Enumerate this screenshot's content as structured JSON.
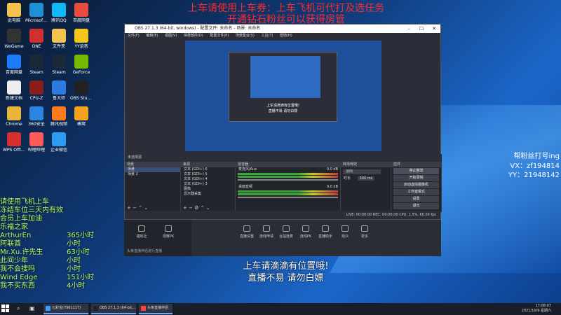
{
  "overlay": {
    "top_line1": "上车请使用上车券：上车飞机可代打及选任务",
    "top_line2": "开通钻石粉丝可以获得房管",
    "subtitle_line1": "上车请滴滴有位置哦!",
    "subtitle_line2": "直播不易 请勿白嫖",
    "fan_title": "帮粉丝打号ing",
    "fan_vx": "VX：zf194814",
    "fan_yy": "YY：21948142"
  },
  "chat": [
    {
      "name": "请使用飞机上车",
      "value": ""
    },
    {
      "name": "冻结车位三天内有效",
      "value": ""
    },
    {
      "name": "会员上车加油",
      "value": ""
    },
    {
      "name": "乐福之家",
      "value": ""
    },
    {
      "name": "ArthurEn",
      "value": "365小时"
    },
    {
      "name": "阿联酋",
      "value": "小时"
    },
    {
      "name": "Mr.Xu.许先生",
      "value": "63小时"
    },
    {
      "name": "此间少年",
      "value": "小时"
    },
    {
      "name": "我不会搜吗",
      "value": "小时"
    },
    {
      "name": "Wind Edge",
      "value": "151小时"
    },
    {
      "name": "我不买东西",
      "value": "4小时"
    }
  ],
  "obs": {
    "title": "OBS 27.1.3 (64-bit, windows) - 配置文件: 未命名 - 场景: 未命名",
    "menu": [
      "文件(F)",
      "编辑(E)",
      "视图(V)",
      "停靠部件(D)",
      "配置文件(P)",
      "场景集合(S)",
      "工具(T)",
      "帮助(H)"
    ],
    "preview_caption1": "上车请滴滴有位置哦!",
    "preview_caption2": "直播不易 请勿白嫖",
    "not_selected": "未选择源",
    "docks": {
      "scenes_title": "场景",
      "scenes": [
        "场景",
        "场景 2"
      ],
      "sources_title": "来源",
      "sources": [
        "文本 (GDI+) 6",
        "文本 (GDI+) 5",
        "文本 (GDI+) 4",
        "文本 (GDI+) 3",
        "图像",
        "显示器采集"
      ],
      "mixer_title": "混音器",
      "mixer": [
        {
          "name": "麦克风/Aux",
          "db": "0.0 dB"
        },
        {
          "name": "桌面音频",
          "db": "0.0 dB"
        }
      ],
      "transitions_title": "转场特效",
      "transition_value": "淡出",
      "duration_label": "时长",
      "duration_value": "300 ms",
      "controls_title": "控件",
      "controls": [
        "停止推流",
        "开始录制",
        "启动虚拟摄像机",
        "工作室模式",
        "设置",
        "退出"
      ]
    },
    "status": "LIVE: 00:00:00   REC: 00:00:00   CPU: 1.5%, 60.00 fps"
  },
  "dy_toolbar": {
    "items": [
      "福利社",
      "观赛PK",
      "直播设置",
      "连线申请",
      "合拍连麦",
      "连线PK",
      "直播助手",
      "观众",
      "更多"
    ],
    "footer": "头条直播伴侣进行直播"
  },
  "desktop_icons": [
    {
      "label": "此电脑",
      "color": "#f2c14e"
    },
    {
      "label": "Microsoft Edge",
      "color": "#1e90d6"
    },
    {
      "label": "腾讯QQ",
      "color": "#12b7f5"
    },
    {
      "label": "百度网盘",
      "color": "#e74c3c"
    },
    {
      "label": "WeGame",
      "color": "#333333"
    },
    {
      "label": "ONE",
      "color": "#d23030"
    },
    {
      "label": "文件夹",
      "color": "#f2c14e"
    },
    {
      "label": "YY语音",
      "color": "#f5c518"
    },
    {
      "label": "百度网盘",
      "color": "#1b7cff"
    },
    {
      "label": "Steam",
      "color": "#1b2838"
    },
    {
      "label": "Steam",
      "color": "#1b2838"
    },
    {
      "label": "GeForce",
      "color": "#76b900"
    },
    {
      "label": "新建文档",
      "color": "#eeeeee"
    },
    {
      "label": "CPU-Z",
      "color": "#8a1c1c"
    },
    {
      "label": "鲁大师",
      "color": "#2d7be0"
    },
    {
      "label": "OBS Studio",
      "color": "#222222"
    },
    {
      "label": "Chrome",
      "color": "#e9b43a"
    },
    {
      "label": "360安全",
      "color": "#2a84e0"
    },
    {
      "label": "腾讯视频",
      "color": "#ff7a1a"
    },
    {
      "label": "蜂窝",
      "color": "#f3a21b"
    },
    {
      "label": "WPS Office",
      "color": "#d92e2e"
    },
    {
      "label": "哔哩哔哩",
      "color": "#ff5a5a"
    },
    {
      "label": "企业微信",
      "color": "#2d9cf0"
    }
  ],
  "taskbar": {
    "items": [
      {
        "label": "七彩宝(7961117)",
        "color": "#3aa0ff"
      },
      {
        "label": "OBS 27.1.3 (64-bit...",
        "color": "#222222"
      },
      {
        "label": "头条直播伴侣",
        "color": "#ff4040"
      }
    ],
    "time": "17:08:07",
    "date": "2021/10/9 星期六"
  }
}
